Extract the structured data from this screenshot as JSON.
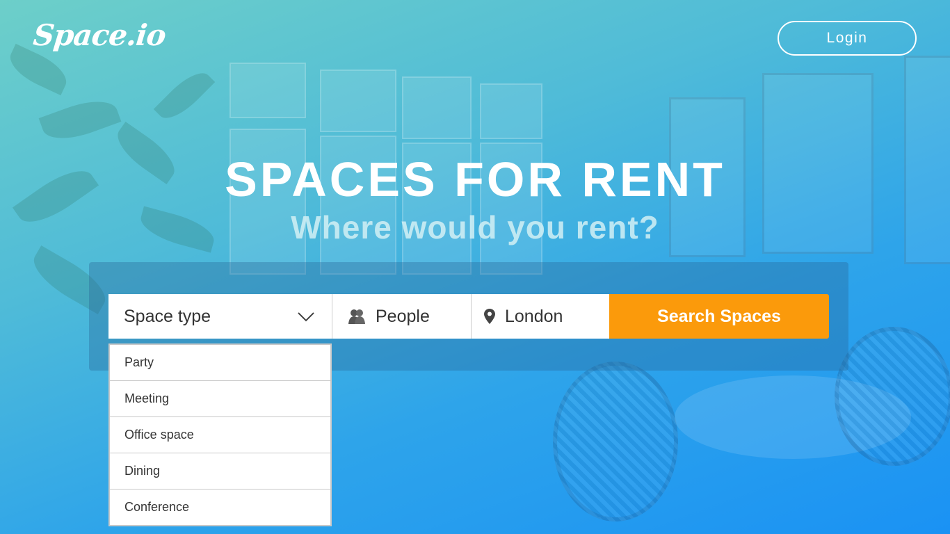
{
  "brand": {
    "logo_text": "Space.io"
  },
  "header": {
    "login_label": "Login"
  },
  "hero": {
    "title": "SPACES FOR RENT",
    "subtitle": "Where would you rent?"
  },
  "search": {
    "space_type_label": "Space type",
    "people_label": "People",
    "location_value": "London",
    "submit_label": "Search Spaces"
  },
  "dropdown": {
    "options": [
      "Party",
      "Meeting",
      "Office space",
      "Dining",
      "Conference"
    ]
  },
  "icons": {
    "chevron": "chevron-down-icon",
    "people": "people-icon",
    "location": "map-pin-icon"
  },
  "colors": {
    "accent": "#fb9a0b",
    "gradient_start": "#6dcfc9",
    "gradient_end": "#1a92f4"
  }
}
